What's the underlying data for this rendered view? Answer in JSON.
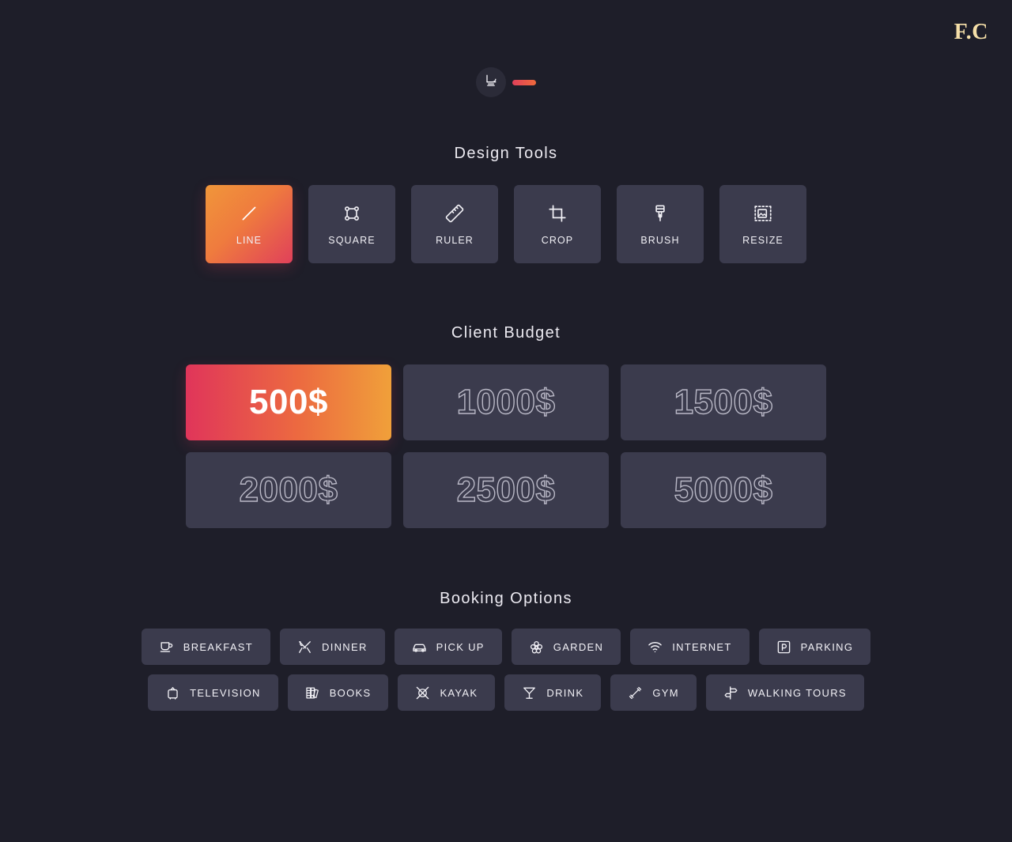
{
  "brand": {
    "logo": "F.C"
  },
  "toggle": {
    "icon": "ice-skate-icon",
    "state": "on",
    "accent_start": "#e0405a",
    "accent_end": "#ef6a3c"
  },
  "theme": {
    "background": "#1e1e29",
    "card": "#3b3b4d",
    "text": "#f2f1f6",
    "outline_text": "#b9b8c6",
    "logo_color": "#f5dfa8",
    "gradient_start": "#e0355a",
    "gradient_end": "#f0a03a"
  },
  "design_tools": {
    "title": "Design Tools",
    "items": [
      {
        "label": "LINE",
        "icon": "line-icon",
        "active": true
      },
      {
        "label": "SQUARE",
        "icon": "square-icon",
        "active": false
      },
      {
        "label": "RULER",
        "icon": "ruler-icon",
        "active": false
      },
      {
        "label": "CROP",
        "icon": "crop-icon",
        "active": false
      },
      {
        "label": "BRUSH",
        "icon": "brush-icon",
        "active": false
      },
      {
        "label": "RESIZE",
        "icon": "resize-icon",
        "active": false
      }
    ]
  },
  "client_budget": {
    "title": "Client Budget",
    "selected": "500$",
    "items": [
      {
        "label": "500$",
        "active": true
      },
      {
        "label": "1000$",
        "active": false
      },
      {
        "label": "1500$",
        "active": false
      },
      {
        "label": "2000$",
        "active": false
      },
      {
        "label": "2500$",
        "active": false
      },
      {
        "label": "5000$",
        "active": false
      }
    ]
  },
  "booking_options": {
    "title": "Booking Options",
    "rows": [
      [
        {
          "label": "BREAKFAST",
          "icon": "coffee-cup-icon"
        },
        {
          "label": "DINNER",
          "icon": "fork-knife-icon"
        },
        {
          "label": "PICK UP",
          "icon": "car-icon"
        },
        {
          "label": "GARDEN",
          "icon": "flower-icon"
        },
        {
          "label": "INTERNET",
          "icon": "wifi-icon"
        },
        {
          "label": "PARKING",
          "icon": "parking-icon"
        }
      ],
      [
        {
          "label": "TELEVISION",
          "icon": "television-icon"
        },
        {
          "label": "BOOKS",
          "icon": "books-icon"
        },
        {
          "label": "KAYAK",
          "icon": "kayak-icon"
        },
        {
          "label": "DRINK",
          "icon": "cocktail-icon"
        },
        {
          "label": "GYM",
          "icon": "dumbbell-icon"
        },
        {
          "label": "WALKING TOURS",
          "icon": "signpost-icon"
        }
      ]
    ]
  }
}
